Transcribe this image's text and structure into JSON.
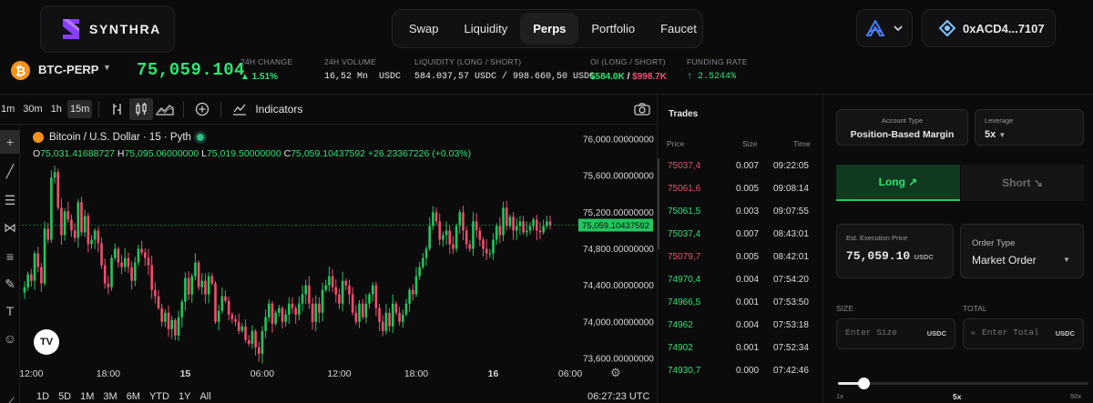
{
  "brand": {
    "name": "SYNTHRA"
  },
  "nav": {
    "items": [
      "Swap",
      "Liquidity",
      "Perps",
      "Portfolio",
      "Faucet"
    ],
    "active": "Perps"
  },
  "wallet": {
    "address": "0xACD4...7107",
    "network_icon": "network-logo-icon"
  },
  "ticker": {
    "pair": "BTC-PERP",
    "last_price": "75,059.104",
    "change_label": "24H CHANGE",
    "change_value": "▲ 1.51%",
    "volume_label": "24H VOLUME",
    "volume_value": "16,52 Mn",
    "volume_unit": "USDC",
    "liquidity_label": "LIQUIDITY (LONG / SHORT)",
    "liquidity_value": "584.037,57 USDC / 998.660,50 USDC",
    "oi_label": "OI (LONG / SHORT)",
    "oi_long": "$584.0K",
    "oi_sep": " / ",
    "oi_short": "$998.7K",
    "funding_label": "FUNDING RATE",
    "funding_value": "↑ 2.5244%"
  },
  "chart": {
    "timeframes": [
      "1m",
      "30m",
      "1h",
      "15m"
    ],
    "active_timeframe": "15m",
    "indicators_label": "Indicators",
    "title": "Bitcoin / U.S. Dollar · 15 · Pyth",
    "ohlc": {
      "o_label": "O",
      "o": "75,031.41688727",
      "h_label": "H",
      "h": "75,095.06000000",
      "l_label": "L",
      "l": "75,019.50000000",
      "c_label": "C",
      "c": "75,059.10437592",
      "change": "+26.23367226 (+0.03%)"
    },
    "range_buttons": [
      "1D",
      "5D",
      "1M",
      "3M",
      "6M",
      "YTD",
      "1Y",
      "All"
    ],
    "clock": "06:27:23 UTC",
    "tv_badge": "TV"
  },
  "chart_data": {
    "type": "candlestick",
    "title": "Bitcoin / U.S. Dollar · 15 · Pyth",
    "ylim": [
      73450,
      76150
    ],
    "y_ticks": [
      "76,000.00000000",
      "75,600.00000000",
      "75,200.00000000",
      "74,800.00000000",
      "74,400.00000000",
      "74,000.00000000",
      "73,600.00000000"
    ],
    "y_tick_values": [
      76000,
      75600,
      75200,
      74800,
      74400,
      74000,
      73600
    ],
    "x_ticks": [
      "12:00",
      "18:00",
      "15",
      "06:00",
      "12:00",
      "18:00",
      "16",
      "06:00"
    ],
    "x_tick_index": [
      2,
      25,
      48,
      71,
      94,
      117,
      140,
      163
    ],
    "current_price": 75059.10437592,
    "current_price_label": "75,059.10437592",
    "close_series": [
      74380,
      74520,
      74450,
      74750,
      74600,
      74420,
      75020,
      74900,
      75580,
      75640,
      75250,
      74950,
      75210,
      75120,
      75000,
      74920,
      75310,
      74980,
      75160,
      74850,
      74900,
      75000,
      74860,
      74620,
      74420,
      74380,
      74700,
      74800,
      74650,
      74600,
      74700,
      74600,
      74450,
      74650,
      74800,
      74760,
      74700,
      74620,
      74350,
      74280,
      74150,
      74000,
      74100,
      73920,
      74020,
      73850,
      74050,
      74220,
      74480,
      74300,
      74500,
      74650,
      74380,
      74450,
      74300,
      74500,
      74420,
      74000,
      74120,
      74280,
      74230,
      74080,
      74030,
      74000,
      73900,
      73950,
      73800,
      73760,
      73900,
      73720,
      73650,
      73900,
      74050,
      74200,
      73980,
      74100,
      74150,
      74000,
      74080,
      74200,
      74150,
      74080,
      74200,
      74300,
      74400,
      74200,
      74000,
      74200,
      74100,
      74350,
      74400,
      74500,
      74380,
      74300,
      74200,
      74450,
      74400,
      74300,
      74100,
      74000,
      74200,
      74050,
      74200,
      74300,
      74400,
      74150,
      74000,
      73900,
      74100,
      73950,
      74200,
      74100,
      74000,
      74080,
      74200,
      74350,
      74300,
      74500,
      74600,
      74700,
      74800,
      75050,
      75200,
      75100,
      74900,
      74950,
      75000,
      74850,
      74800,
      75050,
      75200,
      75000,
      74850,
      74800,
      75100,
      75000,
      74900,
      74800,
      74750,
      74750,
      74900,
      75050,
      74950,
      75250,
      75050,
      75150,
      75000,
      75050,
      75100,
      74980,
      75000,
      75050,
      75120,
      75000,
      74980,
      75050,
      75100,
      75059
    ],
    "open_series_note": ""
  },
  "trades": {
    "title": "Trades",
    "headers": {
      "price": "Price",
      "size": "Size",
      "time": "Time"
    },
    "rows": [
      {
        "price": "75037,4",
        "size": "0.007",
        "time": "09:22:05",
        "side": "sell"
      },
      {
        "price": "75061,6",
        "size": "0.005",
        "time": "09:08:14",
        "side": "sell"
      },
      {
        "price": "75061,5",
        "size": "0.003",
        "time": "09:07:55",
        "side": "buy"
      },
      {
        "price": "75037,4",
        "size": "0.007",
        "time": "08:43:01",
        "side": "buy"
      },
      {
        "price": "75079,7",
        "size": "0.005",
        "time": "08:42:01",
        "side": "sell"
      },
      {
        "price": "74970,4",
        "size": "0.004",
        "time": "07:54:20",
        "side": "buy"
      },
      {
        "price": "74966,5",
        "size": "0.001",
        "time": "07:53:50",
        "side": "buy"
      },
      {
        "price": "74962",
        "size": "0.004",
        "time": "07:53:18",
        "side": "buy"
      },
      {
        "price": "74902",
        "size": "0.001",
        "time": "07:52:34",
        "side": "buy"
      },
      {
        "price": "74930,7",
        "size": "0.000",
        "time": "07:42:46",
        "side": "buy"
      }
    ]
  },
  "order": {
    "account_type_label": "Account Type",
    "account_type_value": "Position-Based Margin",
    "leverage_label": "Leverage",
    "leverage_value": "5x",
    "long_label": "Long",
    "short_label": "Short",
    "est_price_label": "Est. Execution Price",
    "est_price_value": "75,059.10",
    "est_price_unit": "USDC",
    "order_type_label": "Order Type",
    "order_type_value": "Market Order",
    "size_label": "SIZE",
    "size_placeholder": "Enter Size",
    "size_unit": "USDC",
    "total_label": "TOTAL",
    "total_placeholder": "Enter Total",
    "total_unit": "USDC",
    "leverage_slider": {
      "min_label": "1x",
      "mid_label": "5x",
      "max_label": "50x",
      "value_fraction": 0.1
    }
  },
  "colors": {
    "up": "#22c55e",
    "down": "#ef4f6e",
    "accent": "#2ee374"
  }
}
